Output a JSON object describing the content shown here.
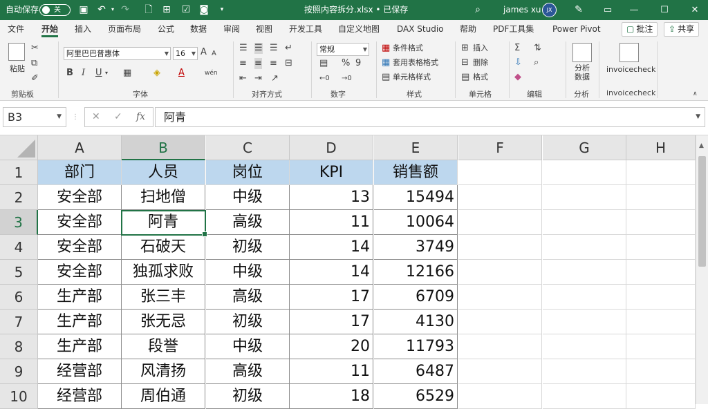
{
  "titlebar": {
    "autosave_label": "自动保存",
    "autosave_state": "关",
    "doc_title": "按照内容拆分.xlsx • 已保存",
    "user_name": "james xu",
    "user_initials": "JX"
  },
  "tabs": [
    "文件",
    "开始",
    "插入",
    "页面布局",
    "公式",
    "数据",
    "审阅",
    "视图",
    "开发工具",
    "自定义地图",
    "DAX Studio",
    "帮助",
    "PDF工具集",
    "Power Pivot"
  ],
  "tab_buttons": {
    "comment": "批注",
    "share": "共享"
  },
  "ribbon": {
    "clipboard": {
      "paste": "粘贴",
      "label": "剪贴板"
    },
    "font": {
      "name": "阿里巴巴普惠体",
      "size": "16",
      "label": "字体",
      "bold": "B",
      "italic": "I",
      "underline": "U",
      "grow": "A",
      "shrink": "A"
    },
    "alignment": {
      "label": "对齐方式"
    },
    "number": {
      "format": "常规",
      "label": "数字",
      "percent": "%",
      "comma": "9"
    },
    "styles": {
      "conditional": "条件格式",
      "table": "套用表格格式",
      "cell": "单元格样式",
      "label": "样式"
    },
    "cells": {
      "insert": "插入",
      "delete": "删除",
      "format": "格式",
      "label": "单元格"
    },
    "editing": {
      "label": "编辑"
    },
    "analysis": {
      "button": "分析数据",
      "label": "分析"
    },
    "invoice": {
      "button": "invoicecheck",
      "label": "invoicecheck"
    }
  },
  "formula_bar": {
    "name_box": "B3",
    "value": "阿青",
    "fx": "fx"
  },
  "columns": [
    "A",
    "B",
    "C",
    "D",
    "E",
    "F",
    "G",
    "H"
  ],
  "rows": [
    "1",
    "2",
    "3",
    "4",
    "5",
    "6",
    "7",
    "8",
    "9",
    "10"
  ],
  "table": {
    "headers": [
      "部门",
      "人员",
      "岗位",
      "KPI",
      "销售额"
    ],
    "rows": [
      [
        "安全部",
        "扫地僧",
        "中级",
        "13",
        "15494"
      ],
      [
        "安全部",
        "阿青",
        "高级",
        "11",
        "10064"
      ],
      [
        "安全部",
        "石破天",
        "初级",
        "14",
        "3749"
      ],
      [
        "安全部",
        "独孤求败",
        "中级",
        "14",
        "12166"
      ],
      [
        "生产部",
        "张三丰",
        "高级",
        "17",
        "6709"
      ],
      [
        "生产部",
        "张无忌",
        "初级",
        "17",
        "4130"
      ],
      [
        "生产部",
        "段誉",
        "中级",
        "20",
        "11793"
      ],
      [
        "经营部",
        "风清扬",
        "高级",
        "11",
        "6487"
      ],
      [
        "经营部",
        "周伯通",
        "初级",
        "18",
        "6529"
      ]
    ]
  },
  "selection": {
    "column": "B",
    "row": "3"
  },
  "colors": {
    "accent": "#217346",
    "header_fill": "#bdd7ee"
  }
}
